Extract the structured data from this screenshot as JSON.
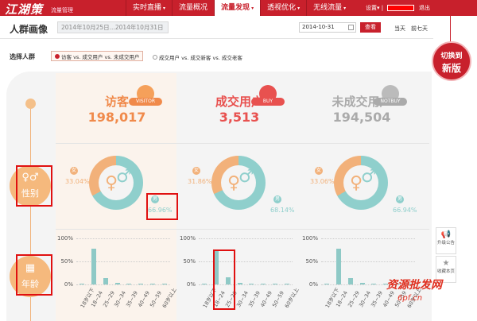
{
  "header": {
    "logo": "江湖策",
    "logo_sub": "流量管理",
    "nav": [
      {
        "label": "实时直播",
        "caret": "▾",
        "active": false
      },
      {
        "label": "流量概况",
        "caret": "",
        "active": false
      },
      {
        "label": "流量发现",
        "caret": "▾",
        "active": true
      },
      {
        "label": "透视优化",
        "caret": "▾",
        "active": false
      },
      {
        "label": "无线流量",
        "caret": "▾",
        "active": false
      }
    ],
    "settings": "设置▾ |",
    "logout": "退出"
  },
  "page": {
    "title": "人群画像",
    "date_range": "2014年10月25日...2014年10月31日",
    "date_value": "2014-10-31",
    "query_btn": "查看",
    "link_today": "当天",
    "link_7days": "前七天"
  },
  "badge": {
    "line1": "切换到",
    "line2": "新版"
  },
  "filter": {
    "label": "选择人群",
    "option1": "访客 vs. 成交用户 vs. 未成交用户",
    "option2": "成交用户 vs. 成交新客 vs. 成交老客"
  },
  "categories": [
    {
      "icon": "♀♂",
      "label": "性别"
    },
    {
      "icon": "▦",
      "label": "年龄"
    }
  ],
  "columns": [
    {
      "title": "访客",
      "tag": "VISITOR",
      "count": "198,017",
      "color": "#f08a4b",
      "tag_color": "#f08a4b",
      "female_label": "女",
      "female_pct": "33.04%",
      "male_label": "男",
      "male_pct": "66.96%",
      "female_frac": 0.3304,
      "avatar_color": "#f5a05a"
    },
    {
      "title": "成交用户",
      "tag": "BUY",
      "count": "3,513",
      "color": "#e8514f",
      "tag_color": "#e8514f",
      "female_label": "女",
      "female_pct": "31.86%",
      "male_label": "男",
      "male_pct": "68.14%",
      "female_frac": 0.3186,
      "avatar_color": "#e8514f"
    },
    {
      "title": "未成交用户",
      "tag": "NOTBUY",
      "count": "194,504",
      "color": "#aaaaaa",
      "tag_color": "#aaaaaa",
      "female_label": "女",
      "female_pct": "33.06%",
      "male_label": "男",
      "male_pct": "66.94%",
      "female_frac": 0.3306,
      "avatar_color": "#bbbbbb"
    }
  ],
  "age_axis": {
    "top": "100%",
    "mid": "50%",
    "bottom": "0%"
  },
  "chart_data": [
    {
      "type": "bar",
      "categories": [
        "18岁以下",
        "18~24",
        "25~29",
        "30~34",
        "35~39",
        "40~49",
        "50~59",
        "60岁以上"
      ],
      "values": [
        1,
        77,
        14,
        3,
        1,
        1,
        0.5,
        0.5
      ],
      "ylim": [
        0,
        100
      ]
    },
    {
      "type": "bar",
      "categories": [
        "18岁以下",
        "18~24",
        "25~29",
        "30~34",
        "35~39",
        "40~49",
        "50~59",
        "60岁以上"
      ],
      "values": [
        0.5,
        75,
        16,
        3,
        2,
        1,
        0.5,
        0.5
      ],
      "ylim": [
        0,
        100
      ]
    },
    {
      "type": "bar",
      "categories": [
        "18岁以下",
        "18~24",
        "25~29",
        "30~34",
        "35~39",
        "40~49",
        "50~59",
        "60岁以上"
      ],
      "values": [
        1,
        77,
        14,
        3,
        1,
        1,
        0.5,
        0.5
      ],
      "ylim": [
        0,
        100
      ]
    }
  ],
  "side": [
    {
      "icon": "📢",
      "label": "升级公告"
    },
    {
      "icon": "★",
      "label": "收藏本页"
    }
  ],
  "watermark": {
    "line1": "资源批发网",
    "line2": "6pf.cn"
  }
}
